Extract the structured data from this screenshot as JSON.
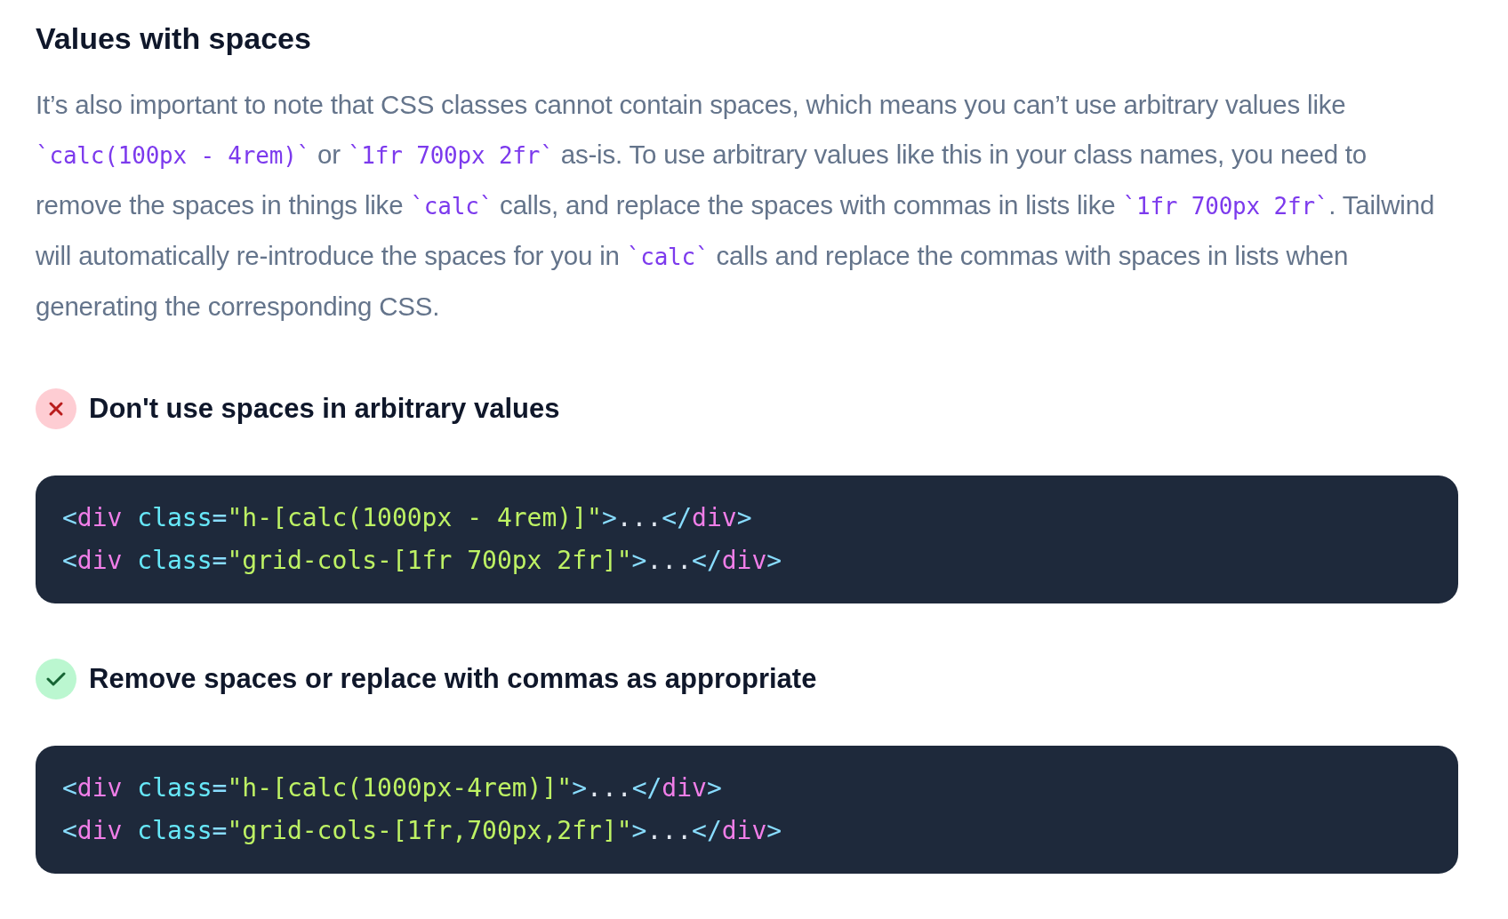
{
  "heading": "Values with spaces",
  "paragraph": [
    {
      "kind": "text",
      "text": "It’s also important to note that CSS classes cannot contain spaces, which means you can’t use arbitrary values like "
    },
    {
      "kind": "code",
      "text": "`calc(100px - 4rem)`"
    },
    {
      "kind": "text",
      "text": " or "
    },
    {
      "kind": "code",
      "text": "`1fr 700px 2fr`"
    },
    {
      "kind": "text",
      "text": " as-is. To use arbitrary values like this in your class names, you need to remove the spaces in things like "
    },
    {
      "kind": "code",
      "text": "`calc`"
    },
    {
      "kind": "text",
      "text": " calls, and replace the spaces with commas in lists like "
    },
    {
      "kind": "code",
      "text": "`1fr 700px 2fr`"
    },
    {
      "kind": "text",
      "text": ". Tailwind will automatically re-introduce the spaces for you in "
    },
    {
      "kind": "code",
      "text": "`calc`"
    },
    {
      "kind": "text",
      "text": " calls and replace the commas with spaces in lists when generating the corresponding CSS."
    }
  ],
  "examples": [
    {
      "kind": "bad",
      "title": "Don't use spaces in arbitrary values",
      "lines": [
        [
          {
            "kind": "punct",
            "text": "<"
          },
          {
            "kind": "tag",
            "text": "div"
          },
          {
            "kind": "attr",
            "text": " class"
          },
          {
            "kind": "punct",
            "text": "="
          },
          {
            "kind": "string",
            "text": "\"h-[calc(1000px - 4rem)]\""
          },
          {
            "kind": "punct",
            "text": ">"
          },
          {
            "kind": "text",
            "text": "..."
          },
          {
            "kind": "punct",
            "text": "</"
          },
          {
            "kind": "tag",
            "text": "div"
          },
          {
            "kind": "punct",
            "text": ">"
          }
        ],
        [
          {
            "kind": "punct",
            "text": "<"
          },
          {
            "kind": "tag",
            "text": "div"
          },
          {
            "kind": "attr",
            "text": " class"
          },
          {
            "kind": "punct",
            "text": "="
          },
          {
            "kind": "string",
            "text": "\"grid-cols-[1fr 700px 2fr]\""
          },
          {
            "kind": "punct",
            "text": ">"
          },
          {
            "kind": "text",
            "text": "..."
          },
          {
            "kind": "punct",
            "text": "</"
          },
          {
            "kind": "tag",
            "text": "div"
          },
          {
            "kind": "punct",
            "text": ">"
          }
        ]
      ]
    },
    {
      "kind": "good",
      "title": "Remove spaces or replace with commas as appropriate",
      "lines": [
        [
          {
            "kind": "punct",
            "text": "<"
          },
          {
            "kind": "tag",
            "text": "div"
          },
          {
            "kind": "attr",
            "text": " class"
          },
          {
            "kind": "punct",
            "text": "="
          },
          {
            "kind": "string",
            "text": "\"h-[calc(1000px-4rem)]\""
          },
          {
            "kind": "punct",
            "text": ">"
          },
          {
            "kind": "text",
            "text": "..."
          },
          {
            "kind": "punct",
            "text": "</"
          },
          {
            "kind": "tag",
            "text": "div"
          },
          {
            "kind": "punct",
            "text": ">"
          }
        ],
        [
          {
            "kind": "punct",
            "text": "<"
          },
          {
            "kind": "tag",
            "text": "div"
          },
          {
            "kind": "attr",
            "text": " class"
          },
          {
            "kind": "punct",
            "text": "="
          },
          {
            "kind": "string",
            "text": "\"grid-cols-[1fr,700px,2fr]\""
          },
          {
            "kind": "punct",
            "text": ">"
          },
          {
            "kind": "text",
            "text": "..."
          },
          {
            "kind": "punct",
            "text": "</"
          },
          {
            "kind": "tag",
            "text": "div"
          },
          {
            "kind": "punct",
            "text": ">"
          }
        ]
      ]
    }
  ]
}
